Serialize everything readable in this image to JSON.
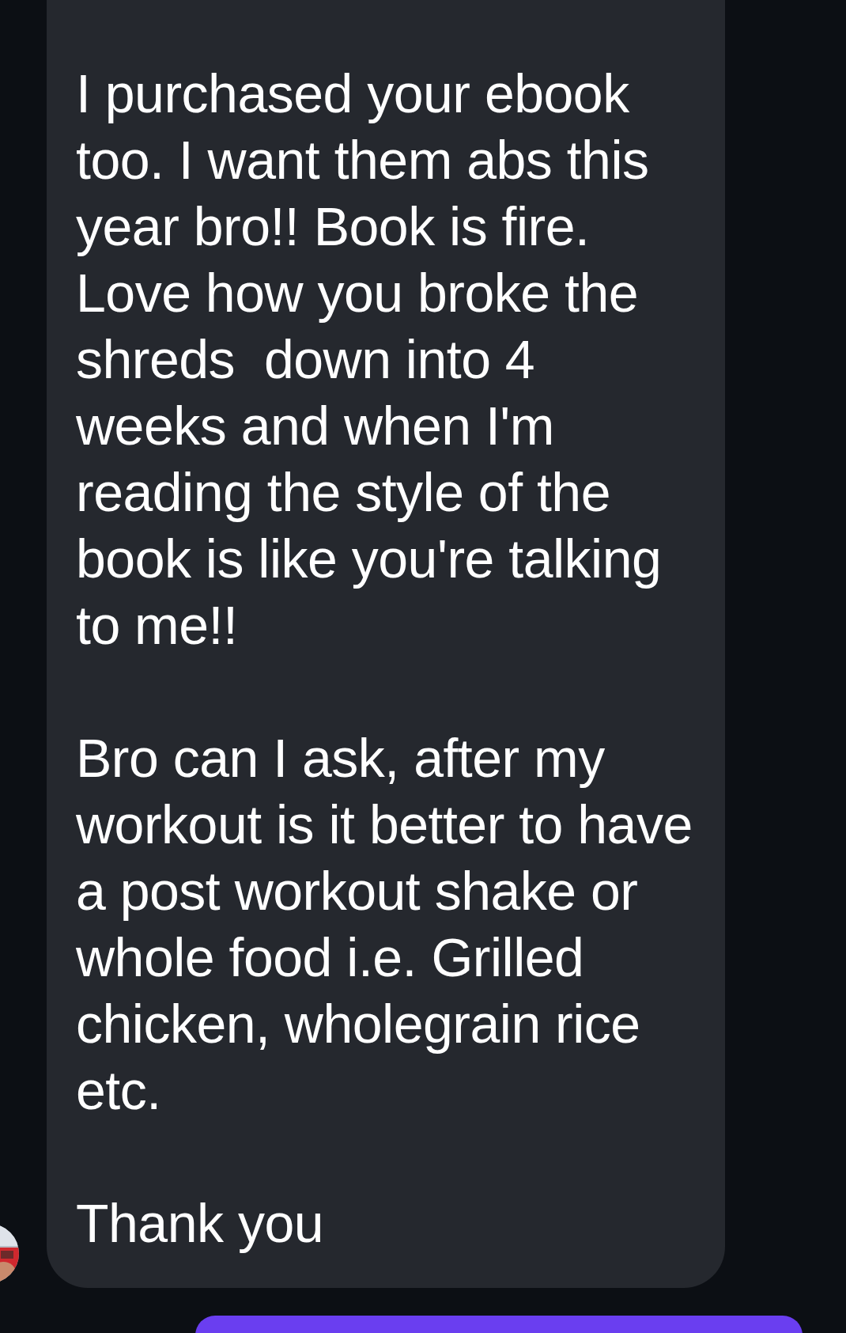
{
  "message": {
    "paragraphs": [
      "I purchased your ebook too. I want them abs this year bro!! Book is fire. Love how you broke the shreds  down into 4 weeks and when I'm reading the style of the book is like you're talking to me!!",
      "Bro can I ask, after my workout is it better to have a post workout shake or whole food i.e. Grilled chicken, wholegrain rice etc.",
      "Thank you"
    ]
  }
}
